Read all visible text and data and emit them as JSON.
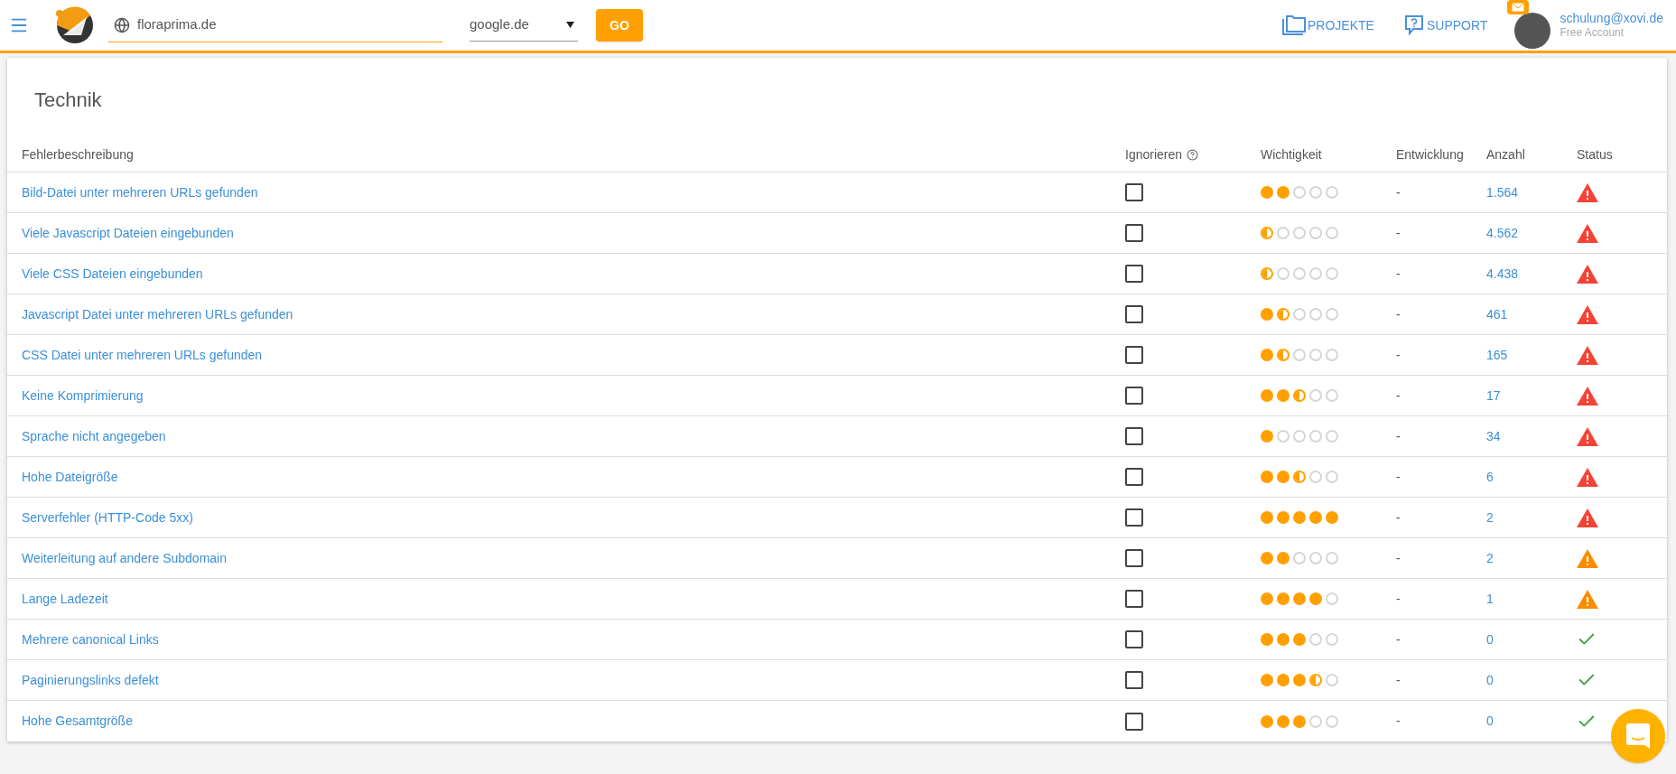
{
  "header": {
    "domain": {
      "value": "floraprima.de"
    },
    "search_engine": {
      "value": "google.de"
    },
    "go_button": "GO",
    "nav": [
      "PROJEKTE",
      "SUPPORT"
    ],
    "user": {
      "email": "schulung@xovi.de",
      "plan": "Free Account"
    }
  },
  "card": {
    "title": "Technik",
    "columns": [
      "Fehlerbeschreibung",
      "Ignorieren",
      "Wichtigkeit",
      "Entwicklung",
      "Anzahl",
      "Status"
    ],
    "rows": [
      {
        "description": "Bild-Datei unter mehreren URLs gefunden",
        "ignored": false,
        "stars": 2,
        "trend": "-",
        "count": "1.564",
        "kind": "error"
      },
      {
        "description": "Viele Javascript Dateien eingebunden",
        "ignored": false,
        "stars": 0.5,
        "trend": "-",
        "count": "4.562",
        "kind": "error"
      },
      {
        "description": "Viele CSS Dateien eingebunden",
        "ignored": false,
        "stars": 0.5,
        "trend": "-",
        "count": "4.438",
        "kind": "error"
      },
      {
        "description": "Javascript Datei unter mehreren URLs gefunden",
        "ignored": false,
        "stars": 1.5,
        "trend": "-",
        "count": "461",
        "kind": "error"
      },
      {
        "description": "CSS Datei unter mehreren URLs gefunden",
        "ignored": false,
        "stars": 1.5,
        "trend": "-",
        "count": "165",
        "kind": "error"
      },
      {
        "description": "Keine Komprimierung",
        "ignored": false,
        "stars": 2.5,
        "trend": "-",
        "count": "17",
        "kind": "error"
      },
      {
        "description": "Sprache nicht angegeben",
        "ignored": false,
        "stars": 1,
        "trend": "-",
        "count": "34",
        "kind": "error"
      },
      {
        "description": "Hohe Dateigröße",
        "ignored": false,
        "stars": 2.5,
        "trend": "-",
        "count": "6",
        "kind": "error"
      },
      {
        "description": "Serverfehler (HTTP-Code 5xx)",
        "ignored": false,
        "stars": 5,
        "trend": "-",
        "count": "2",
        "kind": "error"
      },
      {
        "description": "Weiterleitung auf andere Subdomain",
        "ignored": false,
        "stars": 2,
        "trend": "-",
        "count": "2",
        "kind": "warning"
      },
      {
        "description": "Lange Ladezeit",
        "ignored": false,
        "stars": 4,
        "trend": "-",
        "count": "1",
        "kind": "warning"
      },
      {
        "description": "Mehrere canonical Links",
        "ignored": false,
        "stars": 3,
        "trend": "-",
        "count": "0",
        "kind": "ok"
      },
      {
        "description": "Paginierungslinks defekt",
        "ignored": false,
        "stars": 3.5,
        "trend": "-",
        "count": "0",
        "kind": "ok"
      },
      {
        "description": "Hohe Gesamtgröße",
        "ignored": false,
        "stars": 3,
        "trend": "-",
        "count": "0",
        "kind": "ok"
      }
    ]
  }
}
